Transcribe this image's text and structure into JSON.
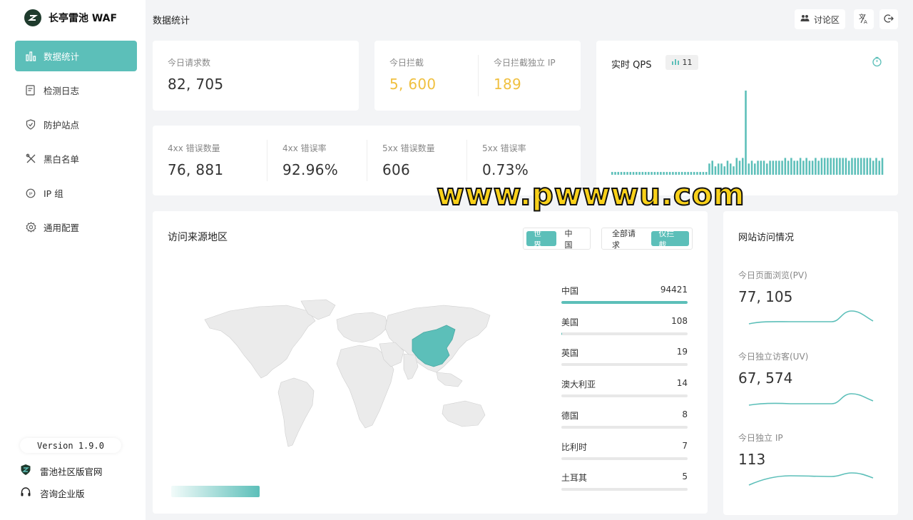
{
  "brand": {
    "name": "长亭雷池 WAF"
  },
  "sidebar": {
    "items": [
      {
        "label": "数据统计",
        "icon": "bar-chart-icon",
        "active": true
      },
      {
        "label": "检测日志",
        "icon": "log-icon",
        "active": false
      },
      {
        "label": "防护站点",
        "icon": "shield-icon",
        "active": false
      },
      {
        "label": "黑白名单",
        "icon": "tools-icon",
        "active": false
      },
      {
        "label": "IP 组",
        "icon": "ip-icon",
        "active": false
      },
      {
        "label": "通用配置",
        "icon": "gear-icon",
        "active": false
      }
    ],
    "version": "Version 1.9.0",
    "community": "雷池社区版官网",
    "enterprise": "咨询企业版"
  },
  "header": {
    "title": "数据统计",
    "discuss": "讨论区"
  },
  "stats": {
    "today_requests": {
      "label": "今日请求数",
      "value": "82, 705"
    },
    "today_blocked": {
      "label": "今日拦截",
      "value": "5, 600"
    },
    "today_blocked_ip": {
      "label": "今日拦截独立 IP",
      "value": "189"
    },
    "err4xx_count": {
      "label": "4xx 错误数量",
      "value": "76, 881"
    },
    "err4xx_rate": {
      "label": "4xx 错误率",
      "value": "92.96%"
    },
    "err5xx_count": {
      "label": "5xx 错误数量",
      "value": "606"
    },
    "err5xx_rate": {
      "label": "5xx 错误率",
      "value": "0.73%"
    }
  },
  "qps": {
    "title": "实时 QPS",
    "badge": "11",
    "values": [
      1,
      1,
      1,
      1,
      1,
      1,
      1,
      1,
      1,
      1,
      1,
      1,
      1,
      1,
      1,
      1,
      1,
      1,
      1,
      1,
      1,
      1,
      1,
      1,
      1,
      1,
      1,
      1,
      1,
      1,
      1,
      1,
      4,
      5,
      3,
      4,
      4,
      3,
      5,
      4,
      3,
      6,
      5,
      6,
      30,
      4,
      5,
      4,
      5,
      5,
      5,
      4,
      5,
      5,
      5,
      5,
      5,
      6,
      5,
      6,
      5,
      5,
      6,
      5,
      6,
      5,
      5,
      6,
      5,
      6,
      6,
      6,
      6,
      6,
      6,
      6,
      6,
      6,
      5,
      6,
      6,
      6,
      6,
      6,
      6,
      6,
      5,
      6,
      5,
      6
    ]
  },
  "geo": {
    "title": "访问来源地区",
    "scope_world": "世界",
    "scope_china": "中国",
    "filter_all": "全部请求",
    "filter_blocked": "仅拦截",
    "ranking": [
      {
        "name": "中国",
        "count": 94421
      },
      {
        "name": "美国",
        "count": 108
      },
      {
        "name": "英国",
        "count": 19
      },
      {
        "name": "澳大利亚",
        "count": 14
      },
      {
        "name": "德国",
        "count": 8
      },
      {
        "name": "比利时",
        "count": 7
      },
      {
        "name": "土耳其",
        "count": 5
      }
    ],
    "highlight_color": "#5cbfb9"
  },
  "visits": {
    "title": "网站访问情况",
    "pv": {
      "label": "今日页面浏览(PV)",
      "value": "77, 105"
    },
    "uv": {
      "label": "今日独立访客(UV)",
      "value": "67, 574"
    },
    "ip": {
      "label": "今日独立 IP",
      "value": "113"
    }
  },
  "watermark": "www.pwwwu.com",
  "colors": {
    "accent": "#5cbfb9",
    "warn": "#f0c040"
  }
}
